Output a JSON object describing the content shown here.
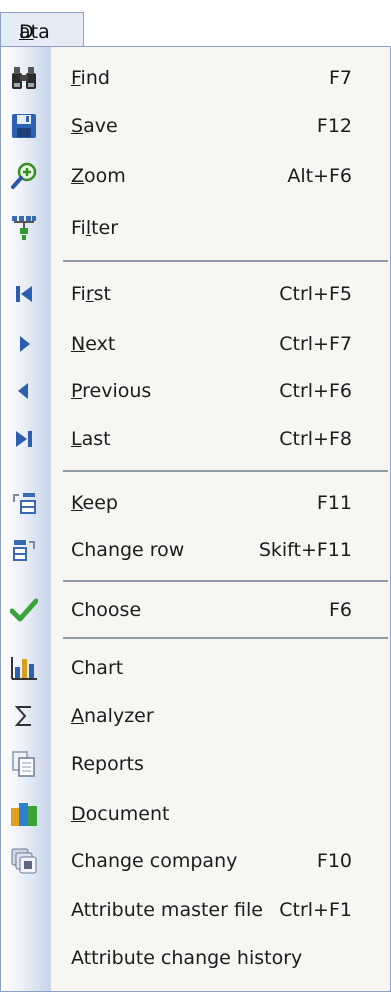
{
  "menubar": {
    "title_first": "D",
    "title_rest": "ata"
  },
  "items": [
    {
      "first": "F",
      "rest": "ind",
      "shortcut": "F7",
      "icon": "binoculars-icon"
    },
    {
      "first": "S",
      "rest": "ave",
      "shortcut": "F12",
      "icon": "save-disk-icon"
    },
    {
      "first": "Z",
      "rest": "oom",
      "shortcut": "Alt+F6",
      "icon": "magnifier-zoom-icon"
    },
    {
      "pre": "Fi",
      "first": "l",
      "rest": "ter",
      "shortcut": "",
      "icon": "filter-icon"
    },
    {
      "pre": "Fi",
      "first": "r",
      "rest": "st",
      "shortcut": "Ctrl+F5",
      "icon": "first-record-icon"
    },
    {
      "first": "N",
      "rest": "ext",
      "shortcut": "Ctrl+F7",
      "icon": "next-record-icon"
    },
    {
      "first": "P",
      "rest": "revious",
      "shortcut": "Ctrl+F6",
      "icon": "previous-record-icon"
    },
    {
      "first": "L",
      "rest": "ast",
      "shortcut": "Ctrl+F8",
      "icon": "last-record-icon"
    },
    {
      "first": "K",
      "rest": "eep",
      "shortcut": "F11",
      "icon": "keep-icon"
    },
    {
      "first": "",
      "rest": "Change row",
      "shortcut": "Skift+F11",
      "icon": "change-row-icon"
    },
    {
      "first": "",
      "rest": "Choose",
      "shortcut": "F6",
      "icon": "checkmark-icon"
    },
    {
      "first": "",
      "rest": "Chart",
      "shortcut": "",
      "icon": "bar-chart-icon"
    },
    {
      "first": "A",
      "rest": "nalyzer",
      "shortcut": "",
      "icon": "sigma-icon"
    },
    {
      "first": "",
      "rest": "Reports",
      "shortcut": "",
      "icon": "reports-icon"
    },
    {
      "first": "D",
      "rest": "ocument",
      "shortcut": "",
      "icon": "document-icon"
    },
    {
      "first": "",
      "rest": "Change company",
      "shortcut": "F10",
      "icon": "change-company-icon"
    },
    {
      "first": "",
      "rest": "Attribute master file",
      "shortcut": "Ctrl+F1",
      "icon": ""
    },
    {
      "first": "",
      "rest": "Attribute change history",
      "shortcut": "",
      "icon": ""
    }
  ]
}
